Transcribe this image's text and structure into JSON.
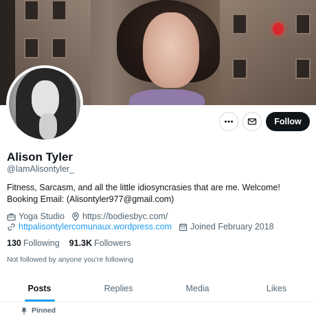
{
  "profile": {
    "name": "Alison Tyler",
    "handle": "@IamAlisontyler_",
    "bio": "Fitness, Sarcasm, and all the little idiosyncrasies that are me. Welcome! Booking Email: (Alisontyler977@gmail.com)",
    "category": "Yoga Studio",
    "website": "https://bodiesbyc.com/",
    "link2": "httpalisontylercomunaux.wordpress.com",
    "joined": "Joined February 2018",
    "following_count": "130",
    "following_label": "Following",
    "followers_count": "91.3K",
    "followers_label": "Followers",
    "not_followed_text": "Not followed by anyone you're following"
  },
  "actions": {
    "follow_label": "Follow",
    "more_icon": "more-horizontal-icon",
    "message_icon": "envelope-icon"
  },
  "tabs": [
    {
      "label": "Posts",
      "active": true
    },
    {
      "label": "Replies",
      "active": false
    },
    {
      "label": "Media",
      "active": false
    },
    {
      "label": "Likes",
      "active": false
    }
  ],
  "pinned_label": "Pinned",
  "colors": {
    "accent": "#1d9bf0",
    "text_primary": "#0f1419",
    "text_secondary": "#536471",
    "follow_button_bg": "#0f1419"
  }
}
